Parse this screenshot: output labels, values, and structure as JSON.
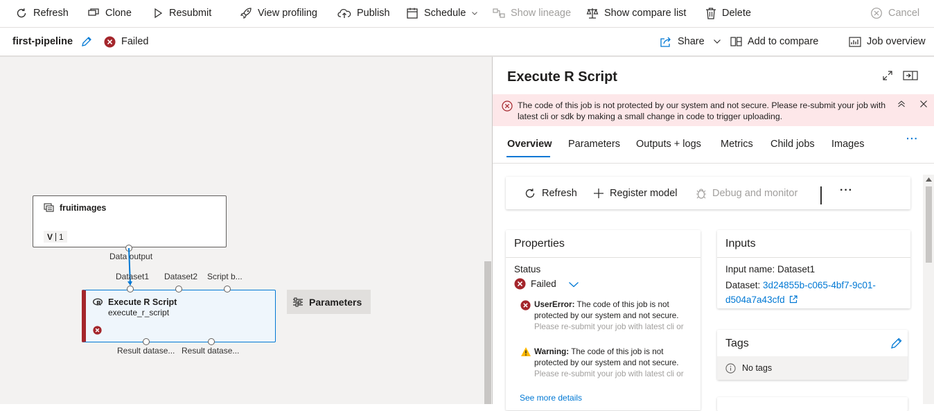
{
  "toolbar": {
    "refresh": "Refresh",
    "clone": "Clone",
    "resubmit": "Resubmit",
    "view_profiling": "View profiling",
    "publish": "Publish",
    "schedule": "Schedule",
    "show_lineage": "Show lineage",
    "show_compare_list": "Show compare list",
    "delete": "Delete",
    "cancel": "Cancel"
  },
  "titlebar": {
    "pipeline_name": "first-pipeline",
    "status": "Failed",
    "share": "Share",
    "add_to_compare": "Add to compare",
    "job_overview": "Job overview"
  },
  "canvas": {
    "dataset_node": {
      "name": "fruitimages",
      "version_label": "V",
      "version": "1",
      "output_port": "Data output"
    },
    "module_node": {
      "name": "Execute R Script",
      "subname": "execute_r_script",
      "inputs": [
        "Dataset1",
        "Dataset2",
        "Script b..."
      ],
      "outputs": [
        "Result datase...",
        "Result datase..."
      ]
    },
    "parameters_button": "Parameters"
  },
  "panel": {
    "title": "Execute R Script",
    "banner": "The code of this job is not protected by our system and not secure. Please re-submit your job with latest cli or sdk by making a small change in code to trigger uploading.",
    "tabs": [
      "Overview",
      "Parameters",
      "Outputs + logs",
      "Metrics",
      "Child jobs",
      "Images"
    ],
    "actions": {
      "refresh": "Refresh",
      "register_model": "Register model",
      "debug": "Debug and monitor"
    },
    "properties": {
      "header": "Properties",
      "status_label": "Status",
      "status_value": "Failed",
      "error_label": "UserError:",
      "error_line1": "The code of this job is not",
      "error_line2": "protected by our system and not secure.",
      "error_line3": "Please re-submit your job with latest cli or",
      "warning_label": "Warning:",
      "warning_line1": "The code of this job is not",
      "warning_line2": "protected by our system and not secure.",
      "warning_line3": "Please re-submit your job with latest cli or",
      "see_more": "See more details"
    },
    "inputs": {
      "header": "Inputs",
      "input_name": "Input name: Dataset1",
      "dataset_label": "Dataset:",
      "dataset_link_1": "3d24855b-c065-4bf7-9c01-",
      "dataset_link_2": "d504a7a43cfd"
    },
    "tags": {
      "header": "Tags",
      "empty": "No tags"
    }
  },
  "colors": {
    "accent": "#0078d4",
    "error": "#a4262c",
    "banner_bg": "#fde7e9",
    "warning": "#ffb900"
  }
}
